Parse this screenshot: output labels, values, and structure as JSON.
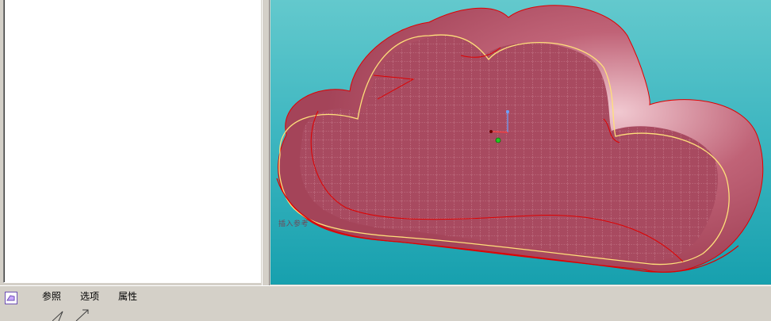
{
  "viewport": {
    "label": "插入参考",
    "icons": {
      "csys": "coordinate-system-icon",
      "origin": "origin-point-icon"
    },
    "colors": {
      "background_top": "#63c9cd",
      "background_bottom": "#17a0ae",
      "model_fill": "#b4566a",
      "edge_red": "#e00000",
      "edge_yellow": "#ffe07a"
    }
  },
  "dashboard": {
    "icon": "insert-feature-icon",
    "tabs": [
      {
        "label": "参照"
      },
      {
        "label": "选项"
      },
      {
        "label": "属性"
      }
    ],
    "tool_icons": [
      "draft-angle-icon",
      "flip-direction-icon"
    ]
  }
}
